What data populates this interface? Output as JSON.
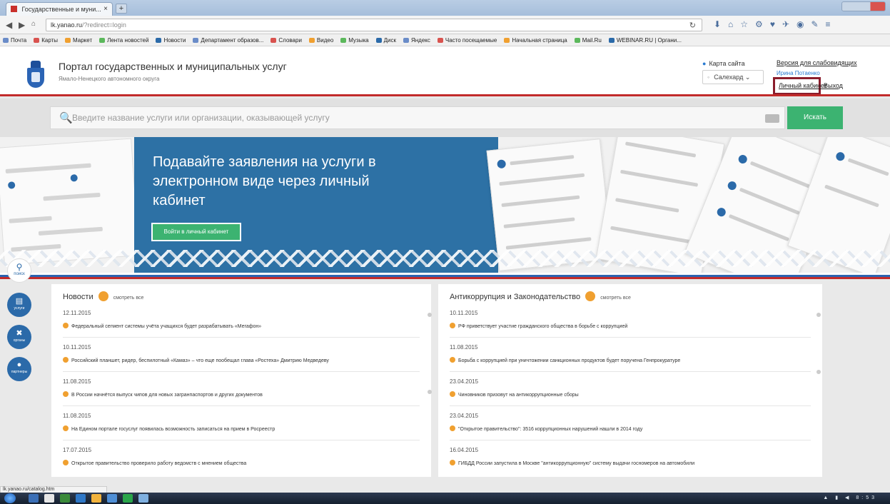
{
  "browser": {
    "tab_title": "Государственные и муни...",
    "tab_close": "×",
    "new_tab": "+",
    "url_host": "lk.yanao.ru",
    "url_path": "/?redirect=login",
    "bookmarks": [
      "Почта",
      "Карты",
      "Маркет",
      "Лента новостей",
      "Новости",
      "Департамент образов...",
      "Словари",
      "Видео",
      "Музыка",
      "Диск",
      "Яндекс",
      "Часто посещаемые",
      "Начальная страница",
      "Mail.Ru",
      "WEBINAR.RU | Органи..."
    ]
  },
  "header": {
    "title": "Портал государственных и муниципальных услуг",
    "subtitle": "Ямало-Ненецкого автономного округа",
    "sitemap": "Карта сайта",
    "region": "Салехард",
    "vision_link": "Версия для слабовидящих",
    "user_link": "Ирина Потаенко",
    "cabinet_link": "Личный кабинет",
    "exit_link": "Выход"
  },
  "search": {
    "placeholder": "Введите название услуги или организации, оказывающей услугу",
    "button": "Искать"
  },
  "banner": {
    "headline": "Подавайте заявления на услуги в электронном виде через личный кабинет",
    "button": "Войти в личный кабинет"
  },
  "sidebar": {
    "search_label": "поиск",
    "items": [
      {
        "label": "услуги"
      },
      {
        "label": "органы"
      },
      {
        "label": "партнеры"
      }
    ]
  },
  "news": {
    "title": "Новости",
    "all_link": "смотреть все",
    "items": [
      {
        "date": "12.11.2015",
        "text": "Федеральный сегмент системы учёта учащихся будет разрабатывать «Мегафон»"
      },
      {
        "date": "10.11.2015",
        "text": "Российский планшет, ридер, беспилотный «Камаз» – что еще пообещал глава «Ростеха» Дмитрию Медведеву"
      },
      {
        "date": "11.08.2015",
        "text": "В России начнётся выпуск чипов для новых загранпаспортов и других документов"
      },
      {
        "date": "11.08.2015",
        "text": "На Едином портале госуслуг появилась возможность записаться на прием в Росреестр"
      },
      {
        "date": "17.07.2015",
        "text": "Открытое правительство проверило работу ведомств с мнением общества"
      }
    ]
  },
  "anticorruption": {
    "title": "Антикоррупция и Законодательство",
    "all_link": "смотреть все",
    "items": [
      {
        "date": "10.11.2015",
        "text": "РФ приветствует участие гражданского общества в борьбе с коррупцией"
      },
      {
        "date": "11.08.2015",
        "text": "Борьба с коррупцией при уничтожении санкционных продуктов будет поручена Генпрокуратуре"
      },
      {
        "date": "23.04.2015",
        "text": "Чиновников призовут на антикоррупционные сборы"
      },
      {
        "date": "23.04.2015",
        "text": "\"Открытое правительство\": 3516 коррупционных нарушений нашли в 2014 году"
      },
      {
        "date": "16.04.2015",
        "text": "ГИБДД России запустила в Москве \"антикоррупционную\" систему выдачи госномеров на автомобили"
      }
    ]
  },
  "status": {
    "url": "lk.yanao.ru/catalog.htm",
    "clock": "8:53"
  },
  "colors": {
    "accent_blue": "#2d71a5",
    "action_green": "#3cb371",
    "brand_red": "#c22b2b",
    "highlight_box": "#8b1d2c",
    "bullet_orange": "#f0a030"
  }
}
